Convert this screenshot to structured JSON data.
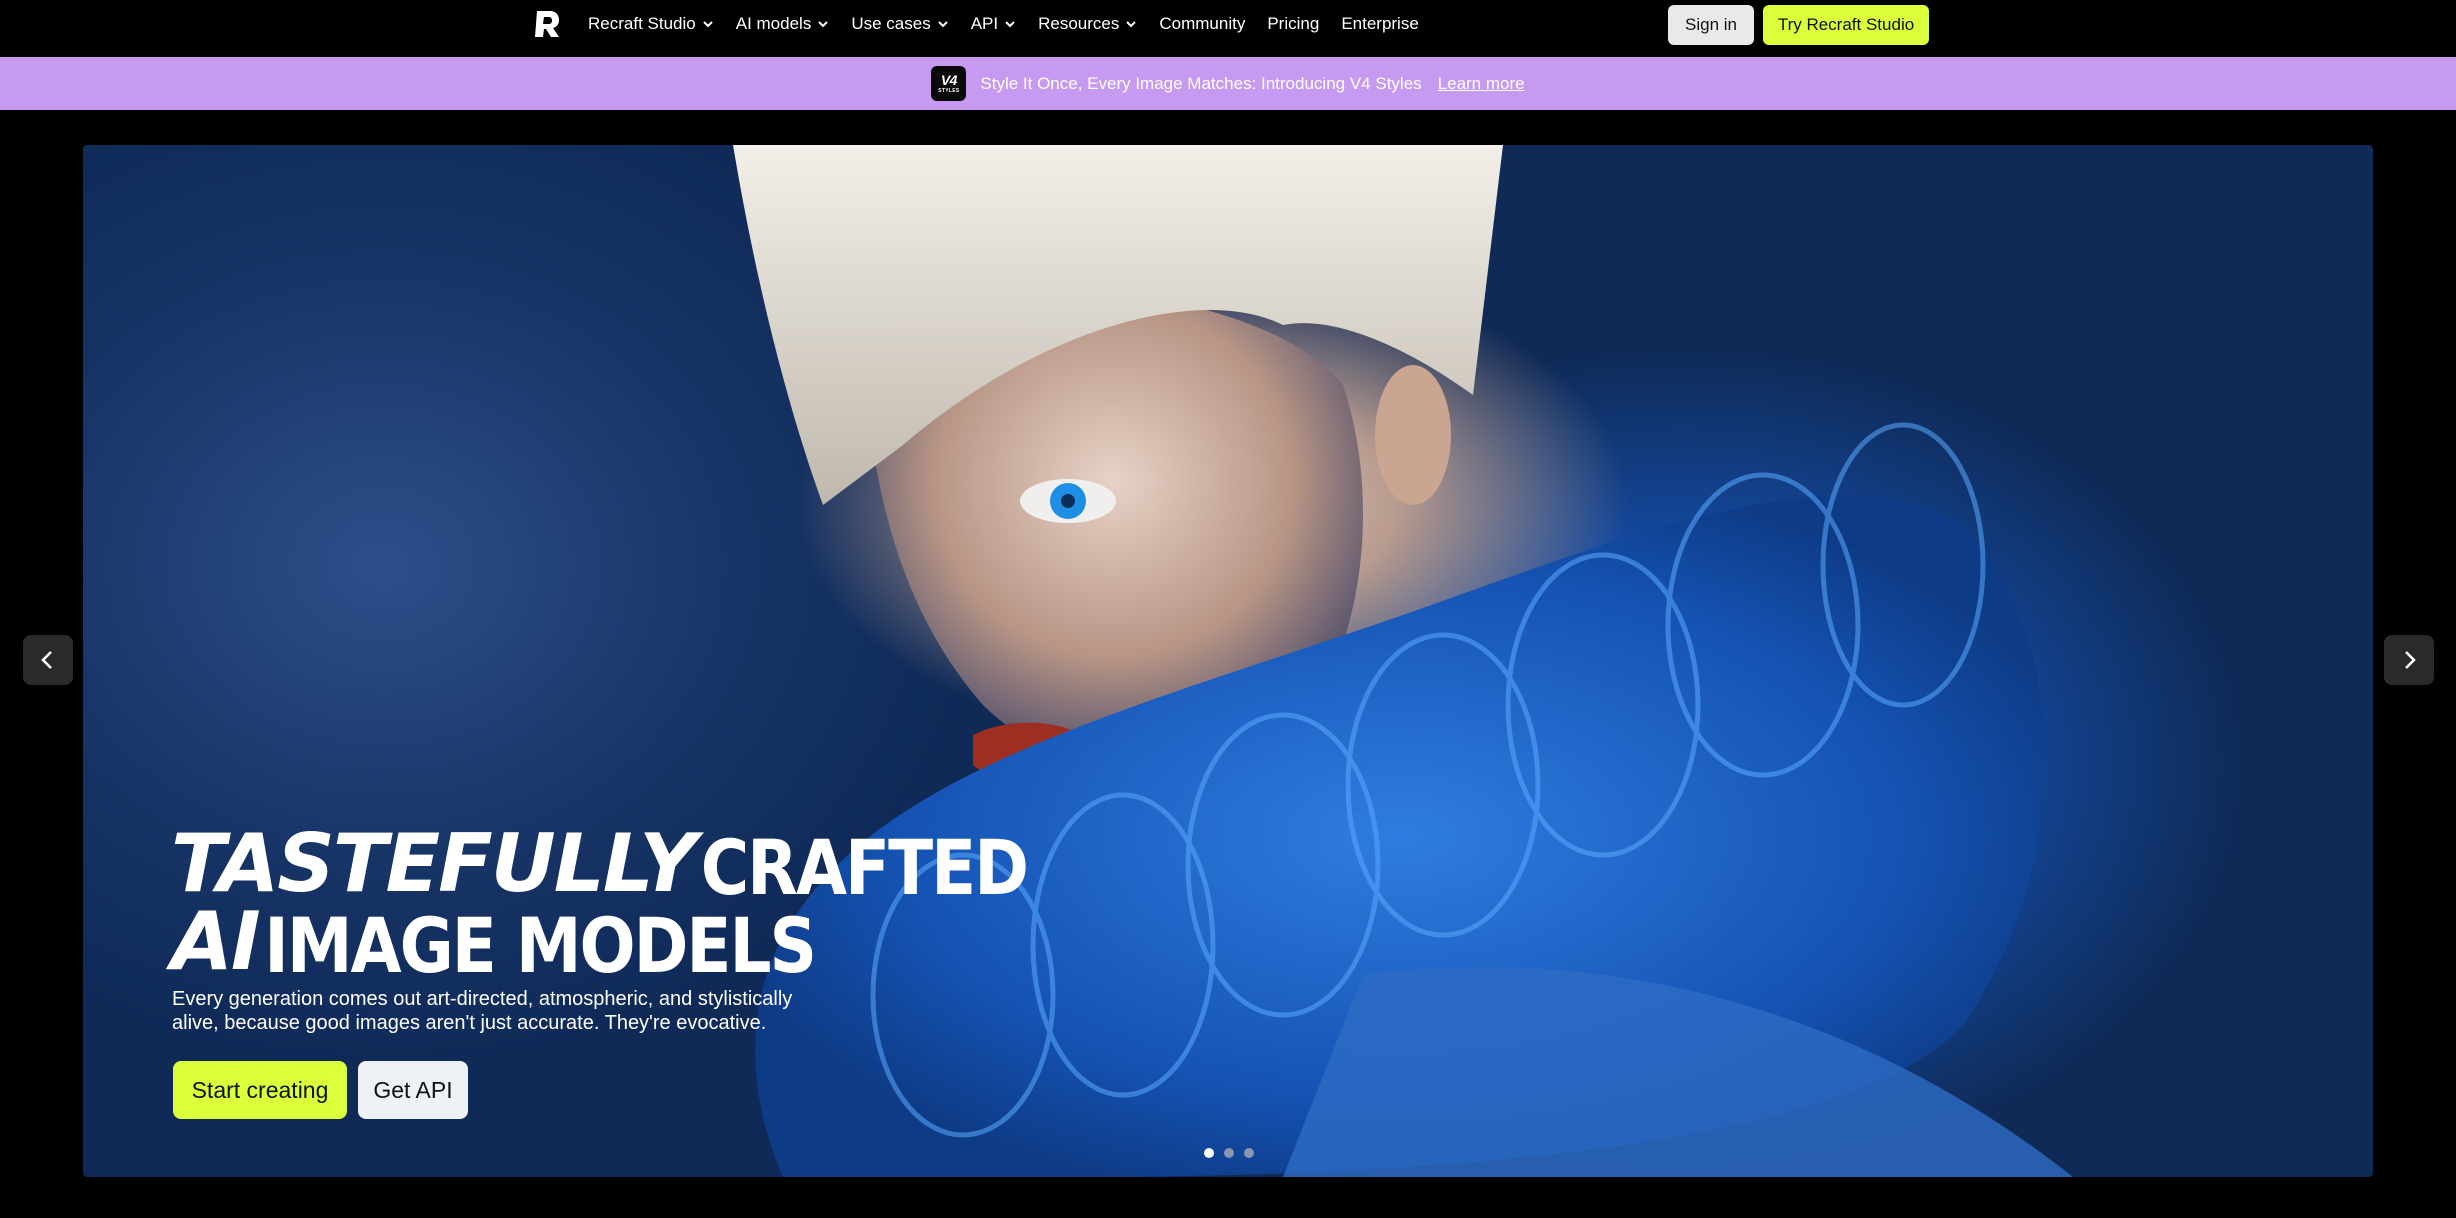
{
  "nav": {
    "items": [
      {
        "label": "Recraft Studio",
        "dropdown": true
      },
      {
        "label": "AI models",
        "dropdown": true
      },
      {
        "label": "Use cases",
        "dropdown": true
      },
      {
        "label": "API",
        "dropdown": true
      },
      {
        "label": "Resources",
        "dropdown": true
      },
      {
        "label": "Community",
        "dropdown": false
      },
      {
        "label": "Pricing",
        "dropdown": false
      },
      {
        "label": "Enterprise",
        "dropdown": false
      }
    ],
    "sign_in": "Sign in",
    "try_studio": "Try Recraft Studio"
  },
  "announcement": {
    "badge_big": "V4",
    "badge_small": "STYLES",
    "text": "Style It Once, Every Image Matches: Introducing V4 Styles",
    "link": "Learn more",
    "background": "#c59af0"
  },
  "hero": {
    "title_line1_italic": "TASTEFULLY",
    "title_line1_cond": "CRAFTED",
    "title_line2_italic": "AI",
    "title_line2_cond": "IMAGE MODELS",
    "description_line1": "Every generation comes out art-directed, atmospheric, and stylistically",
    "description_line2": "alive, because good images aren't just accurate. They're evocative.",
    "start_button": "Start creating",
    "api_button": "Get API",
    "carousel": {
      "slides": 3,
      "active": 1
    }
  },
  "colors": {
    "accent": "#dcff3b",
    "background": "#000000"
  },
  "icons": {
    "logo": "recraft-logo-icon",
    "prev": "chevron-left-icon",
    "next": "chevron-right-icon",
    "dropdown": "chevron-down-icon"
  }
}
